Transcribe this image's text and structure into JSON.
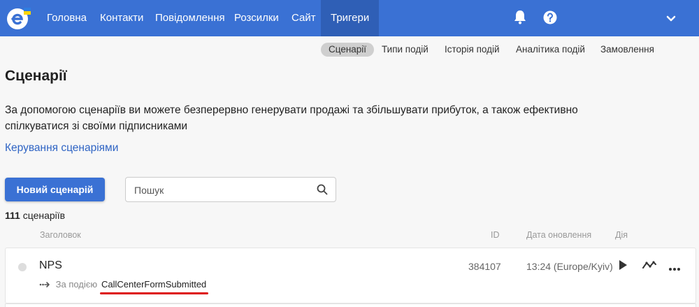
{
  "topnav": {
    "items": [
      {
        "label": "Головна"
      },
      {
        "label": "Контакти"
      },
      {
        "label": "Повідомлення"
      },
      {
        "label": "Розсилки"
      },
      {
        "label": "Сайт"
      },
      {
        "label": "Тригери"
      }
    ],
    "active": "Тригери",
    "icons": [
      "bell-icon",
      "help-icon",
      "chevron-down-icon"
    ]
  },
  "subnav": {
    "items": [
      {
        "label": "Сценарії"
      },
      {
        "label": "Типи подій"
      },
      {
        "label": "Історія подій"
      },
      {
        "label": "Аналітика подій"
      },
      {
        "label": "Замовлення"
      }
    ],
    "active": "Сценарії"
  },
  "page": {
    "title": "Сценарії",
    "description": "За допомогою сценаріїв ви можете безперервно генерувати продажі та збільшувати прибуток, а також ефективно спілкуватися зі своїми підписниками",
    "manage_link": "Керування сценаріями"
  },
  "toolbar": {
    "new_button": "Новий сценарій",
    "search_placeholder": "Пошук"
  },
  "summary": {
    "count": "111",
    "count_label": "сценаріїв"
  },
  "table": {
    "columns": [
      "Заголовок",
      "ID",
      "Дата оновлення",
      "Дія"
    ],
    "rows": [
      {
        "title": "NPS",
        "trigger_prefix": "За подією",
        "event": "CallCenterFormSubmitted",
        "id": "384107",
        "updated": "13:24 (Europe/Kyiv)"
      }
    ]
  },
  "colors": {
    "brand": "#3a71d4",
    "brand_active": "#2f5fb6",
    "link": "#2f64c4",
    "highlight_underline": "#dd1111"
  }
}
